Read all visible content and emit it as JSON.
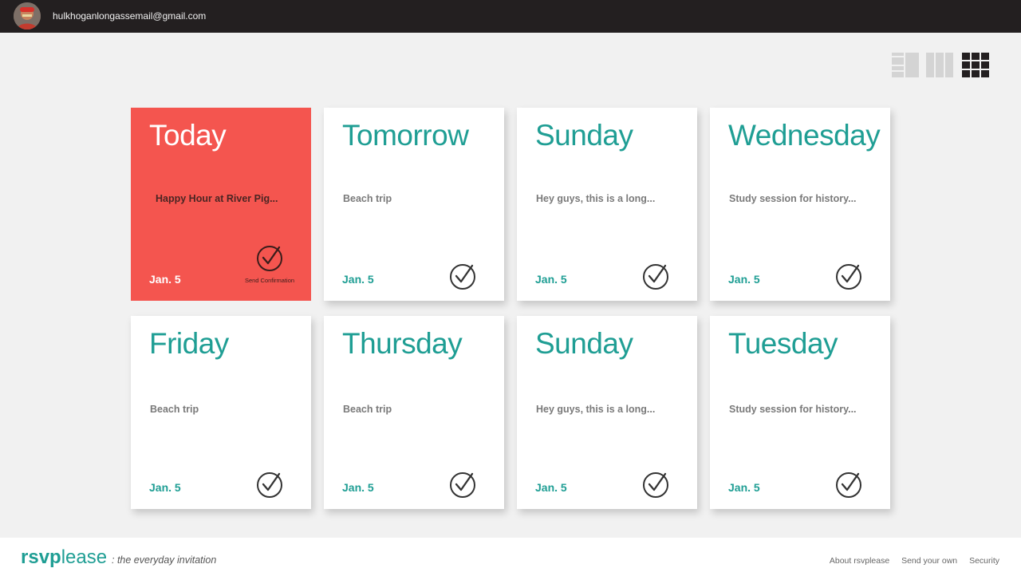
{
  "header": {
    "user_email": "hulkhoganlongassemail@gmail.com"
  },
  "view_modes": [
    {
      "name": "list-view",
      "active": false
    },
    {
      "name": "column-view",
      "active": false
    },
    {
      "name": "grid-view",
      "active": true
    }
  ],
  "cards": [
    {
      "day": "Today",
      "description": "Happy Hour at River Pig...",
      "date": "Jan. 5",
      "active": true,
      "action_label": "Send Confirmation"
    },
    {
      "day": "Tomorrow",
      "description": "Beach trip",
      "date": "Jan. 5",
      "active": false
    },
    {
      "day": "Sunday",
      "description": "Hey guys, this is a long...",
      "date": "Jan. 5",
      "active": false
    },
    {
      "day": "Wednesday",
      "description": "Study session for history...",
      "date": "Jan. 5",
      "active": false
    },
    {
      "day": "Friday",
      "description": "Beach trip",
      "date": "Jan. 5",
      "active": false
    },
    {
      "day": "Thursday",
      "description": "Beach trip",
      "date": "Jan. 5",
      "active": false
    },
    {
      "day": "Sunday",
      "description": "Hey guys, this is a long...",
      "date": "Jan. 5",
      "active": false
    },
    {
      "day": "Tuesday",
      "description": "Study session for history...",
      "date": "Jan. 5",
      "active": false
    }
  ],
  "footer": {
    "brand_bold": "rsvp",
    "brand_light": "lease",
    "tagline": ": the everyday invitation",
    "links": [
      "About rsvplease",
      "Send your own",
      "Security"
    ]
  },
  "colors": {
    "accent": "#1f9e94",
    "active_card": "#f4554f",
    "topbar": "#231f20",
    "background": "#f1f1f1"
  }
}
